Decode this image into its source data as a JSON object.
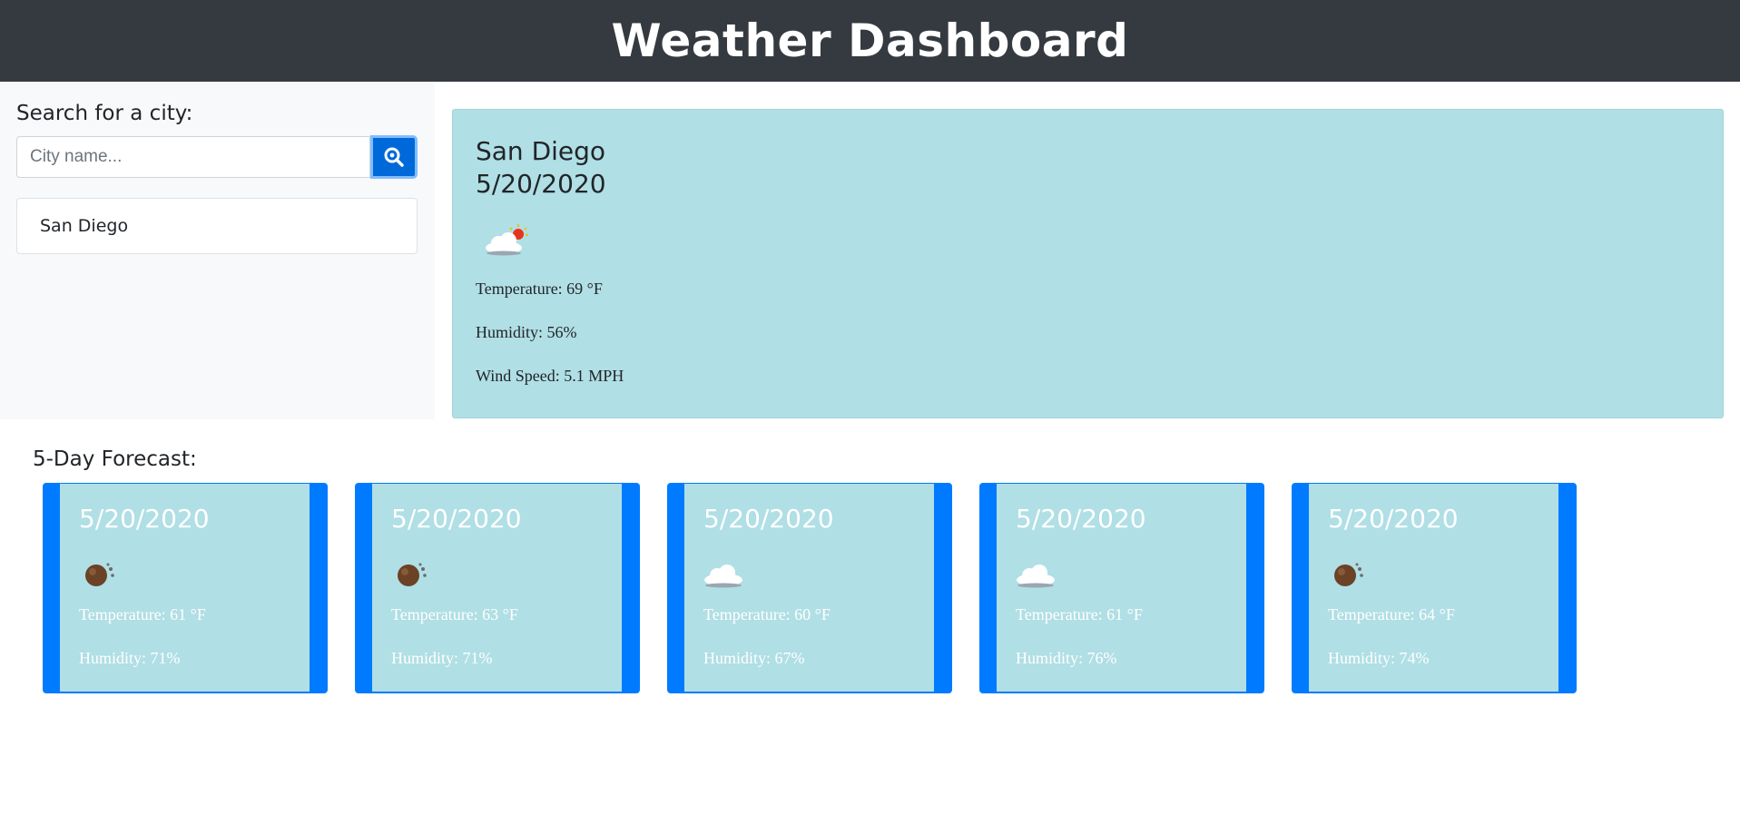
{
  "header": {
    "title": "Weather Dashboard"
  },
  "search": {
    "label": "Search for a city:",
    "placeholder": "City name...",
    "history": [
      "San Diego"
    ]
  },
  "current": {
    "city": "San Diego",
    "date": "5/20/2020",
    "icon": "partly-cloudy-icon",
    "temperature": "Temperature: 69 °F",
    "humidity": "Humidity: 56%",
    "wind": "Wind Speed: 5.1 MPH"
  },
  "forecast": {
    "title": "5-Day Forecast:",
    "days": [
      {
        "date": "5/20/2020",
        "icon": "rain-icon",
        "temperature": "Temperature: 61 °F",
        "humidity": "Humidity: 71%"
      },
      {
        "date": "5/20/2020",
        "icon": "rain-icon",
        "temperature": "Temperature: 63 °F",
        "humidity": "Humidity: 71%"
      },
      {
        "date": "5/20/2020",
        "icon": "cloud-icon",
        "temperature": "Temperature: 60 °F",
        "humidity": "Humidity: 67%"
      },
      {
        "date": "5/20/2020",
        "icon": "cloud-icon",
        "temperature": "Temperature: 61 °F",
        "humidity": "Humidity: 76%"
      },
      {
        "date": "5/20/2020",
        "icon": "rain-icon",
        "temperature": "Temperature: 64 °F",
        "humidity": "Humidity: 74%"
      }
    ]
  },
  "colors": {
    "header_bg": "#343a40",
    "card_bg": "#b0dfe5",
    "accent": "#007bff",
    "button": "#0069d9"
  }
}
